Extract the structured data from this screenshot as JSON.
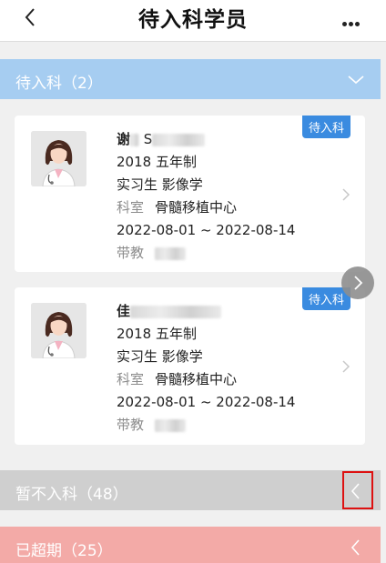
{
  "header": {
    "title": "待入科学员",
    "back_icon": "chevron-left-icon",
    "more_icon": "more-horizontal-icon"
  },
  "sections": {
    "pending": {
      "label": "待入科（2）",
      "color": "#a6cdf1",
      "icon": "chevron-down-icon"
    },
    "not_enter": {
      "label": "暂不入科（48）",
      "color": "#cfcfcf",
      "icon": "chevron-left-icon"
    },
    "expired": {
      "label": "已超期（25）",
      "color": "#f3aaa7",
      "icon": "chevron-left-icon"
    }
  },
  "students": [
    {
      "name_visible": "谢",
      "name_suffix": "S",
      "badge": "待入科",
      "year_program": "2018  五年制",
      "role_major": "实习生  影像学",
      "dept_label": "科室",
      "dept_value": "骨髓移植中心",
      "dates": "2022-08-01 ~ 2022-08-14",
      "teacher_label": "带教"
    },
    {
      "name_visible": "佳",
      "name_suffix": "",
      "badge": "待入科",
      "year_program": "2018  五年制",
      "role_major": "实习生  影像学",
      "dept_label": "科室",
      "dept_value": "骨髓移植中心",
      "dates": "2022-08-01 ~ 2022-08-14",
      "teacher_label": "带教"
    }
  ],
  "colors": {
    "badge": "#3a8be0",
    "highlight": "#d11111"
  }
}
